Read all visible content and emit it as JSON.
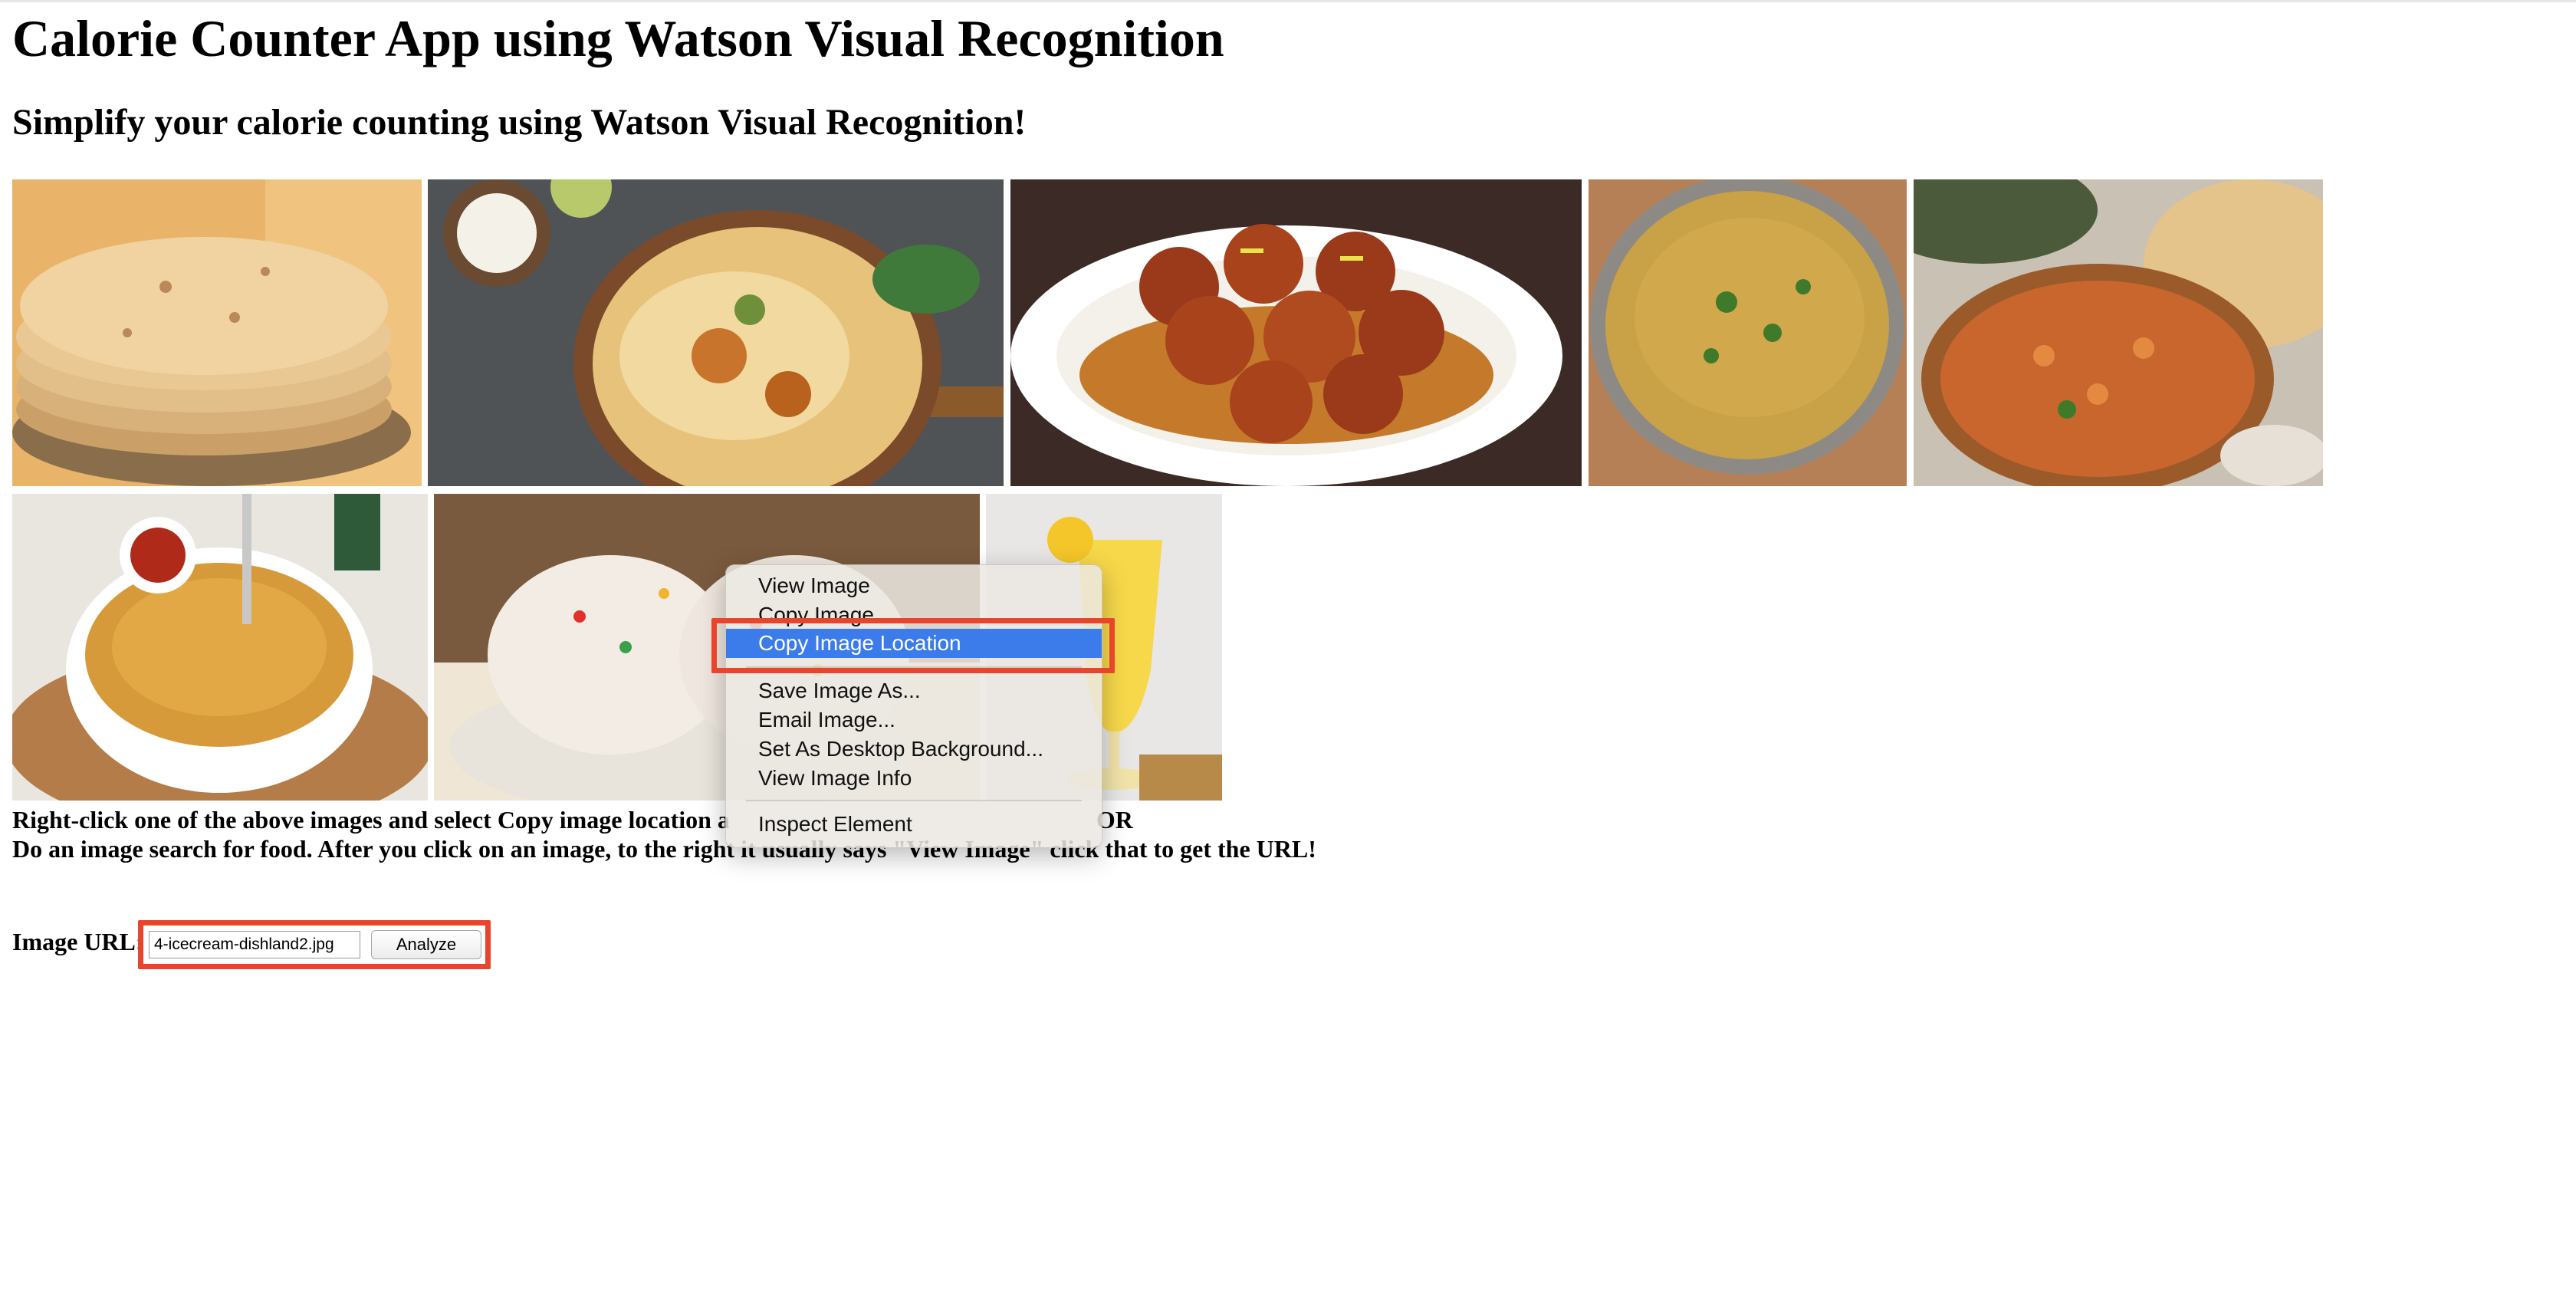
{
  "page": {
    "title": "Calorie Counter App using Watson Visual Recognition",
    "subtitle": "Simplify your calorie counting using Watson Visual Recognition!"
  },
  "gallery": [
    {
      "name": "chapati-image"
    },
    {
      "name": "biryani-image"
    },
    {
      "name": "gulab-jamun-image"
    },
    {
      "name": "dal-image"
    },
    {
      "name": "chole-naan-image"
    },
    {
      "name": "noodles-image"
    },
    {
      "name": "ice-cream-image"
    },
    {
      "name": "pineapple-juice-image"
    }
  ],
  "instructions": {
    "line1": "Right-click one of the above images and select Copy image location a",
    "line1_end": "OR",
    "line2": "Do an image search for food. After you click on an image, to the right it usually says \"View Image\" click that to get the URL!"
  },
  "form": {
    "label": "Image URL:",
    "url_value": "4-icecream-dishland2.jpg",
    "analyze_label": "Analyze"
  },
  "context_menu": {
    "items": [
      {
        "label": "View Image"
      },
      {
        "label": "Copy Image"
      },
      {
        "label": "Copy Image Location",
        "selected": true
      },
      {
        "label": "Save Image As..."
      },
      {
        "label": "Email Image..."
      },
      {
        "label": "Set As Desktop Background..."
      },
      {
        "label": "View Image Info"
      },
      {
        "label": "Inspect Element"
      }
    ]
  },
  "colors": {
    "highlight_box": "#e8452c",
    "menu_selection": "#3b7bea"
  }
}
